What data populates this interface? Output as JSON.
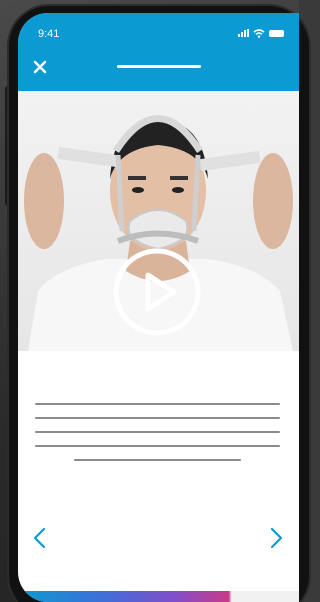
{
  "status_bar": {
    "time": "9:41"
  },
  "header": {
    "close_icon": "close-icon"
  },
  "video": {
    "play_icon": "play-icon"
  },
  "navigation": {
    "prev_icon": "chevron-left-icon",
    "next_icon": "chevron-right-icon"
  },
  "colors": {
    "header": "#0b9ad1",
    "accent": "#0b9ad1",
    "text_placeholder": "#8a8a8a",
    "progress_gradient": [
      "#0b9ad1",
      "#7f4fcc",
      "#c93a8a"
    ]
  }
}
